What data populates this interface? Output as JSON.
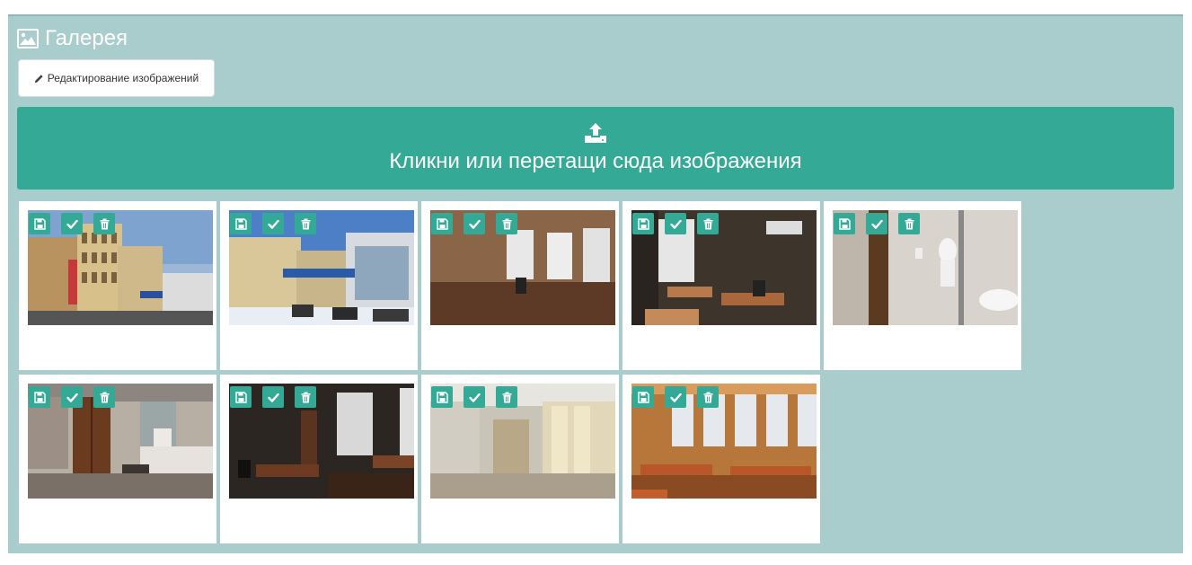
{
  "gallery": {
    "title": "Галерея",
    "title_icon": "image-icon",
    "edit_button_label": "Редактирование изображений",
    "edit_button_icon": "pencil-icon",
    "dropzone_text": "Кликни или перетащи сюда изображения",
    "dropzone_icon": "upload-icon",
    "accent_color": "#33a996",
    "panel_color": "#a9cccd",
    "card_actions": [
      "save-icon",
      "check-icon",
      "trash-icon"
    ],
    "images": [
      {
        "subject": "building-exterior-corner"
      },
      {
        "subject": "building-exterior-street"
      },
      {
        "subject": "empty-room-windows"
      },
      {
        "subject": "office-with-desks"
      },
      {
        "subject": "restroom"
      },
      {
        "subject": "reception-hall"
      },
      {
        "subject": "office-desks-dark"
      },
      {
        "subject": "corridor"
      },
      {
        "subject": "classroom-desks"
      }
    ]
  }
}
